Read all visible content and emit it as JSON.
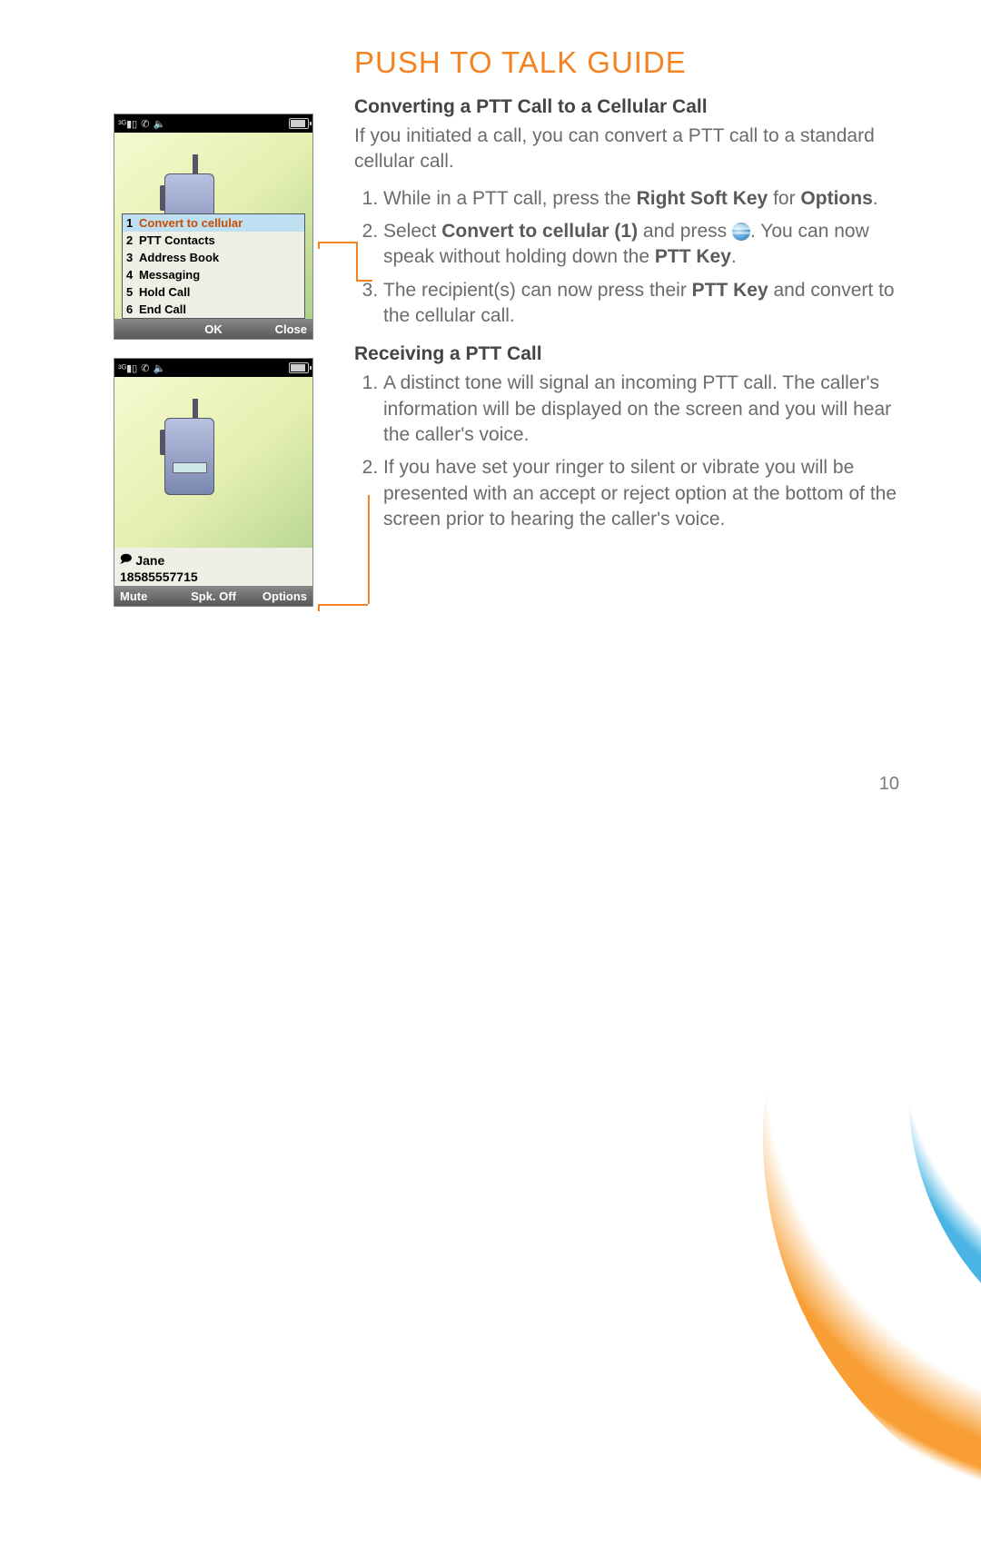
{
  "title": "PUSH TO TALK GUIDE",
  "page_number": "10",
  "section1": {
    "heading": "Converting a PTT Call to a Cellular Call",
    "intro": "If you initiated a call, you can convert a PTT call to a standard cellular call.",
    "step1_a": "While in a PTT call, press the ",
    "step1_b": "Right Soft Key",
    "step1_c": " for ",
    "step1_d": "Options",
    "step1_e": ".",
    "step2_a": "Select ",
    "step2_b": "Convert to cellular (1)",
    "step2_c": " and press ",
    "step2_d": ". You can now speak without holding down the ",
    "step2_e": "PTT Key",
    "step2_f": ".",
    "step3_a": "The recipient(s) can now press their ",
    "step3_b": "PTT Key",
    "step3_c": " and convert to the cellular call."
  },
  "section2": {
    "heading": "Receiving a PTT Call",
    "step1": "A distinct tone will signal an incoming PTT call. The caller's information will be displayed on the screen and you will hear the caller's voice.",
    "step2": "If you have set your ringer to silent or vibrate you will be presented with an accept or reject option at the bottom of the screen prior to hearing the caller's voice."
  },
  "phone1": {
    "menu": {
      "items": [
        {
          "n": "1",
          "label": "Convert to cellular"
        },
        {
          "n": "2",
          "label": "PTT Contacts"
        },
        {
          "n": "3",
          "label": "Address Book"
        },
        {
          "n": "4",
          "label": "Messaging"
        },
        {
          "n": "5",
          "label": "Hold Call"
        },
        {
          "n": "6",
          "label": "End Call"
        }
      ]
    },
    "softkeys": {
      "left": "",
      "center": "OK",
      "right": "Close"
    }
  },
  "phone2": {
    "caller": {
      "name": "Jane",
      "number": "18585557715"
    },
    "softkeys": {
      "left": "Mute",
      "center": "Spk. Off",
      "right": "Options"
    }
  }
}
